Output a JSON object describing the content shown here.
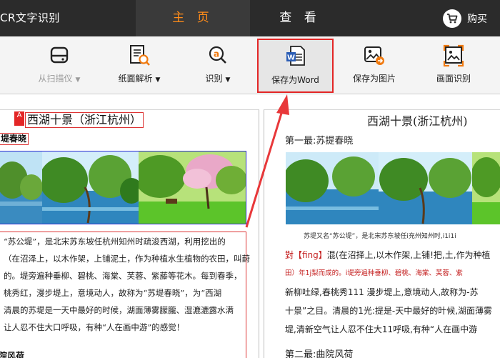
{
  "app": {
    "title": "CR文字识别"
  },
  "nav": {
    "tabs": [
      {
        "label": "主 页",
        "active": true
      },
      {
        "label": "查 看",
        "active": false
      }
    ],
    "buy_label": "购买",
    "buy_icon": "cart-icon"
  },
  "toolbar": {
    "items": [
      {
        "label": "从扫描仪",
        "caret": "▼",
        "icon": "scanner-icon",
        "disabled": true
      },
      {
        "label": "纸面解析",
        "caret": "▼",
        "icon": "page-analyze-icon",
        "disabled": false
      },
      {
        "label": "识别",
        "caret": "▼",
        "icon": "ocr-icon",
        "disabled": false
      },
      {
        "label": "保存为Word",
        "caret": "",
        "icon": "word-doc-icon",
        "disabled": false,
        "highlighted": true
      },
      {
        "label": "保存为图片",
        "caret": "",
        "icon": "image-save-icon",
        "disabled": false
      },
      {
        "label": "画面识别",
        "caret": "",
        "icon": "screen-capture-icon",
        "disabled": false
      }
    ]
  },
  "left_pane": {
    "badge": "A",
    "title": "西湖十景（浙江杭州）",
    "subtitle": "堤春晓",
    "paragraphs": [
      "“苏公堤”，是北宋苏东坡任杭州知州时疏浚西湖，利用挖出的",
      "（在沼泽上，以木作架，上铺泥土，作为种植水生植物的农田，叫葑",
      "的。堤旁遍种垂柳、碧桃、海棠、芙蓉、紫藤等花木。每到春季，",
      "桃秀红，漫步堤上，意境动人，故称为“苏堤春晓”，为“西湖",
      "清晨的苏堤是一天中最好的时候，湖面薄雾朦朧、湿漉漉露水满",
      "让人忍不住大口呼吸，有种“人在画中游”的感觉！"
    ],
    "next_heading": "院风荷"
  },
  "right_pane": {
    "title": "西湖十景(浙江杭州)",
    "subtitle": "第一最:苏提春晓",
    "caption": "苏堤又名“苏公堤”，是北宋苏东坡任i充州知州时,i1i1i",
    "lines": [
      {
        "prefix": "對【fing】",
        "text": "混(在沼择上,以木作架,上铺!把,土,作为种植"
      },
      {
        "prefix": "田）年1j梨而成的。",
        "text": "i堤旁遍种垂柳、碧桃、海棠、芙蓉、紫"
      },
      {
        "prefix": "",
        "text": "新柳吐绿,春桃秀111 漫步堤上,意境动人,故称为-苏"
      },
      {
        "prefix": "",
        "text": "十景”之目。清晨的1光:提是-天中最好的旪候,湖面薄雾"
      },
      {
        "prefix": "",
        "text": "堤,清新空气让人忍不住大11呼吸,有种“人在画中游"
      }
    ],
    "next_heading": "第二最:曲院风荷"
  },
  "colors": {
    "nav_bg": "#2b2b2b",
    "nav_active_text": "#ff8c1a",
    "highlight_border": "#e32626",
    "annotation_arrow": "#e8383a"
  }
}
